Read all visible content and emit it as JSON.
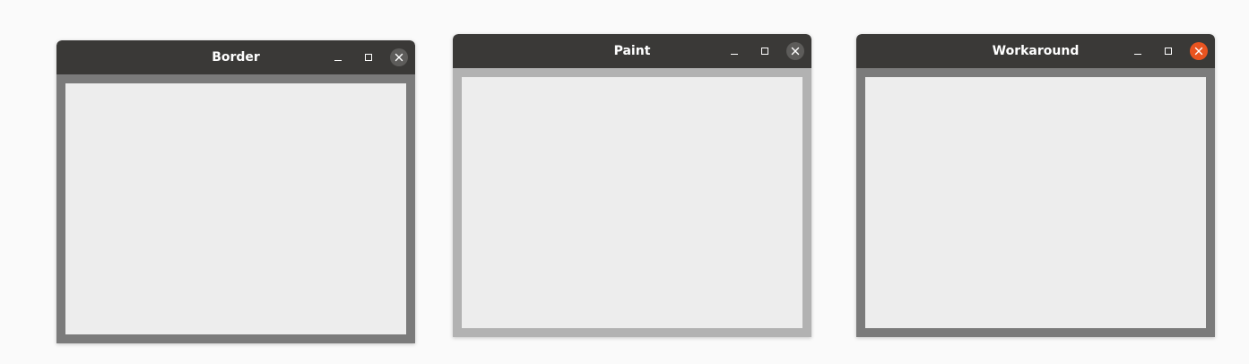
{
  "windows": [
    {
      "title": "Border",
      "border_color": "#7b7b7b",
      "close_button_color": "#5d5c5a",
      "close_icon": "close-icon",
      "minimize_icon": "minimize-icon",
      "maximize_icon": "maximize-icon"
    },
    {
      "title": "Paint",
      "border_color": "#b2b2b2",
      "close_button_color": "#5d5c5a",
      "close_icon": "close-icon",
      "minimize_icon": "minimize-icon",
      "maximize_icon": "maximize-icon"
    },
    {
      "title": "Workaround",
      "border_color": "#7b7b7b",
      "close_button_color": "#e95420",
      "close_icon": "close-icon",
      "minimize_icon": "minimize-icon",
      "maximize_icon": "maximize-icon"
    }
  ]
}
